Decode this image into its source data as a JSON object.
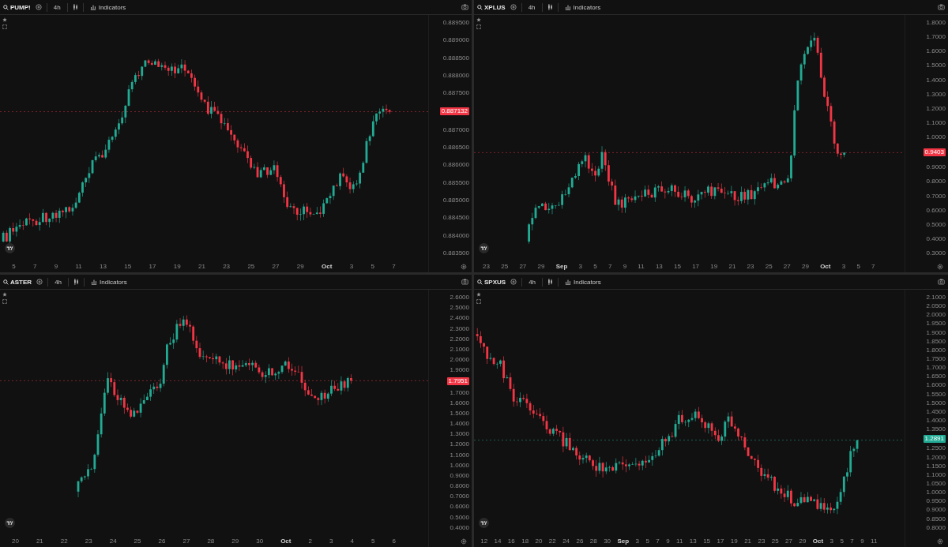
{
  "panels": [
    {
      "symbol": "PUMP!",
      "interval": "4h",
      "indicators": "Indicators",
      "price_labels": [
        {
          "text": "0.889500",
          "kind": "tick"
        },
        {
          "text": "0.889000",
          "kind": "tick"
        },
        {
          "text": "0.888500",
          "kind": "tick"
        },
        {
          "text": "0.888000",
          "kind": "tick"
        },
        {
          "text": "0.887500",
          "kind": "tick"
        },
        {
          "text": "0.887132",
          "kind": "current",
          "color": "#f23645"
        },
        {
          "text": "0.887000",
          "kind": "tick"
        },
        {
          "text": "0.886500",
          "kind": "tick"
        },
        {
          "text": "0.886000",
          "kind": "tick"
        },
        {
          "text": "0.885500",
          "kind": "tick"
        },
        {
          "text": "0.885000",
          "kind": "tick"
        },
        {
          "text": "0.884500",
          "kind": "tick"
        },
        {
          "text": "0.884000",
          "kind": "tick"
        },
        {
          "text": "0.883500",
          "kind": "tick"
        }
      ],
      "time_labels": [
        {
          "text": "5",
          "kind": "day"
        },
        {
          "text": "7",
          "kind": "day"
        },
        {
          "text": "9",
          "kind": "day"
        },
        {
          "text": "11",
          "kind": "day"
        },
        {
          "text": "13",
          "kind": "day"
        },
        {
          "text": "15",
          "kind": "day"
        },
        {
          "text": "17",
          "kind": "day"
        },
        {
          "text": "19",
          "kind": "day"
        },
        {
          "text": "21",
          "kind": "day"
        },
        {
          "text": "23",
          "kind": "day"
        },
        {
          "text": "25",
          "kind": "day"
        },
        {
          "text": "27",
          "kind": "day"
        },
        {
          "text": "29",
          "kind": "day"
        },
        {
          "text": "Oct",
          "kind": "month"
        },
        {
          "text": "3",
          "kind": "day"
        },
        {
          "text": "5",
          "kind": "day"
        },
        {
          "text": "7",
          "kind": "day"
        }
      ]
    },
    {
      "symbol": "XPLUS",
      "interval": "4h",
      "indicators": "Indicators",
      "price_labels": [
        {
          "text": "1.8000",
          "kind": "tick"
        },
        {
          "text": "1.7000",
          "kind": "tick"
        },
        {
          "text": "1.6000",
          "kind": "tick"
        },
        {
          "text": "1.5000",
          "kind": "tick"
        },
        {
          "text": "1.4000",
          "kind": "tick"
        },
        {
          "text": "1.3000",
          "kind": "tick"
        },
        {
          "text": "1.2000",
          "kind": "tick"
        },
        {
          "text": "1.1000",
          "kind": "tick"
        },
        {
          "text": "1.0000",
          "kind": "tick"
        },
        {
          "text": "0.9403",
          "kind": "current",
          "color": "#f23645"
        },
        {
          "text": "0.9000",
          "kind": "tick"
        },
        {
          "text": "0.8000",
          "kind": "tick"
        },
        {
          "text": "0.7000",
          "kind": "tick"
        },
        {
          "text": "0.6000",
          "kind": "tick"
        },
        {
          "text": "0.5000",
          "kind": "tick"
        },
        {
          "text": "0.4000",
          "kind": "tick"
        },
        {
          "text": "0.3000",
          "kind": "tick"
        }
      ],
      "time_labels": [
        {
          "text": "23",
          "kind": "day"
        },
        {
          "text": "25",
          "kind": "day"
        },
        {
          "text": "27",
          "kind": "day"
        },
        {
          "text": "29",
          "kind": "day"
        },
        {
          "text": "Sep",
          "kind": "month"
        },
        {
          "text": "3",
          "kind": "day"
        },
        {
          "text": "5",
          "kind": "day"
        },
        {
          "text": "7",
          "kind": "day"
        },
        {
          "text": "9",
          "kind": "day"
        },
        {
          "text": "11",
          "kind": "day"
        },
        {
          "text": "13",
          "kind": "day"
        },
        {
          "text": "15",
          "kind": "day"
        },
        {
          "text": "17",
          "kind": "day"
        },
        {
          "text": "19",
          "kind": "day"
        },
        {
          "text": "21",
          "kind": "day"
        },
        {
          "text": "23",
          "kind": "day"
        },
        {
          "text": "25",
          "kind": "day"
        },
        {
          "text": "27",
          "kind": "day"
        },
        {
          "text": "29",
          "kind": "day"
        },
        {
          "text": "Oct",
          "kind": "month"
        },
        {
          "text": "3",
          "kind": "day"
        },
        {
          "text": "5",
          "kind": "day"
        },
        {
          "text": "7",
          "kind": "day"
        }
      ]
    },
    {
      "symbol": "ASTER",
      "interval": "4h",
      "indicators": "Indicators",
      "price_labels": [
        {
          "text": "2.6000",
          "kind": "tick"
        },
        {
          "text": "2.5000",
          "kind": "tick"
        },
        {
          "text": "2.4000",
          "kind": "tick"
        },
        {
          "text": "2.3000",
          "kind": "tick"
        },
        {
          "text": "2.2000",
          "kind": "tick"
        },
        {
          "text": "2.1000",
          "kind": "tick"
        },
        {
          "text": "2.0000",
          "kind": "tick"
        },
        {
          "text": "1.9000",
          "kind": "tick"
        },
        {
          "text": "1.7951",
          "kind": "current",
          "color": "#f23645"
        },
        {
          "text": "1.7000",
          "kind": "tick"
        },
        {
          "text": "1.6000",
          "kind": "tick"
        },
        {
          "text": "1.5000",
          "kind": "tick"
        },
        {
          "text": "1.4000",
          "kind": "tick"
        },
        {
          "text": "1.3000",
          "kind": "tick"
        },
        {
          "text": "1.2000",
          "kind": "tick"
        },
        {
          "text": "1.1000",
          "kind": "tick"
        },
        {
          "text": "1.0000",
          "kind": "tick"
        },
        {
          "text": "0.9000",
          "kind": "tick"
        },
        {
          "text": "0.8000",
          "kind": "tick"
        },
        {
          "text": "0.7000",
          "kind": "tick"
        },
        {
          "text": "0.6000",
          "kind": "tick"
        },
        {
          "text": "0.5000",
          "kind": "tick"
        },
        {
          "text": "0.4000",
          "kind": "tick"
        }
      ],
      "time_labels": [
        {
          "text": "20",
          "kind": "day"
        },
        {
          "text": "21",
          "kind": "day"
        },
        {
          "text": "22",
          "kind": "day"
        },
        {
          "text": "23",
          "kind": "day"
        },
        {
          "text": "24",
          "kind": "day"
        },
        {
          "text": "25",
          "kind": "day"
        },
        {
          "text": "26",
          "kind": "day"
        },
        {
          "text": "27",
          "kind": "day"
        },
        {
          "text": "28",
          "kind": "day"
        },
        {
          "text": "29",
          "kind": "day"
        },
        {
          "text": "30",
          "kind": "day"
        },
        {
          "text": "Oct",
          "kind": "month"
        },
        {
          "text": "2",
          "kind": "day"
        },
        {
          "text": "3",
          "kind": "day"
        },
        {
          "text": "4",
          "kind": "day"
        },
        {
          "text": "5",
          "kind": "day"
        },
        {
          "text": "6",
          "kind": "day"
        }
      ]
    },
    {
      "symbol": "SPXUS",
      "interval": "4h",
      "indicators": "Indicators",
      "price_labels": [
        {
          "text": "2.1000",
          "kind": "tick"
        },
        {
          "text": "2.0500",
          "kind": "tick"
        },
        {
          "text": "2.0000",
          "kind": "tick"
        },
        {
          "text": "1.9500",
          "kind": "tick"
        },
        {
          "text": "1.9000",
          "kind": "tick"
        },
        {
          "text": "1.8500",
          "kind": "tick"
        },
        {
          "text": "1.8000",
          "kind": "tick"
        },
        {
          "text": "1.7500",
          "kind": "tick"
        },
        {
          "text": "1.7000",
          "kind": "tick"
        },
        {
          "text": "1.6500",
          "kind": "tick"
        },
        {
          "text": "1.6000",
          "kind": "tick"
        },
        {
          "text": "1.5500",
          "kind": "tick"
        },
        {
          "text": "1.5000",
          "kind": "tick"
        },
        {
          "text": "1.4500",
          "kind": "tick"
        },
        {
          "text": "1.4000",
          "kind": "tick"
        },
        {
          "text": "1.3500",
          "kind": "tick"
        },
        {
          "text": "1.2891",
          "kind": "current",
          "color": "#22ab94"
        },
        {
          "text": "1.2500",
          "kind": "tick"
        },
        {
          "text": "1.2000",
          "kind": "tick"
        },
        {
          "text": "1.1500",
          "kind": "tick"
        },
        {
          "text": "1.1000",
          "kind": "tick"
        },
        {
          "text": "1.0500",
          "kind": "tick"
        },
        {
          "text": "1.0000",
          "kind": "tick"
        },
        {
          "text": "0.9500",
          "kind": "tick"
        },
        {
          "text": "0.9000",
          "kind": "tick"
        },
        {
          "text": "0.8500",
          "kind": "tick"
        },
        {
          "text": "0.8000",
          "kind": "tick"
        }
      ],
      "time_labels": [
        {
          "text": "12",
          "kind": "day"
        },
        {
          "text": "14",
          "kind": "day"
        },
        {
          "text": "16",
          "kind": "day"
        },
        {
          "text": "18",
          "kind": "day"
        },
        {
          "text": "20",
          "kind": "day"
        },
        {
          "text": "22",
          "kind": "day"
        },
        {
          "text": "24",
          "kind": "day"
        },
        {
          "text": "26",
          "kind": "day"
        },
        {
          "text": "28",
          "kind": "day"
        },
        {
          "text": "30",
          "kind": "day"
        },
        {
          "text": "Sep",
          "kind": "month"
        },
        {
          "text": "3",
          "kind": "day"
        },
        {
          "text": "5",
          "kind": "day"
        },
        {
          "text": "7",
          "kind": "day"
        },
        {
          "text": "9",
          "kind": "day"
        },
        {
          "text": "11",
          "kind": "day"
        },
        {
          "text": "13",
          "kind": "day"
        },
        {
          "text": "15",
          "kind": "day"
        },
        {
          "text": "17",
          "kind": "day"
        },
        {
          "text": "19",
          "kind": "day"
        },
        {
          "text": "21",
          "kind": "day"
        },
        {
          "text": "23",
          "kind": "day"
        },
        {
          "text": "25",
          "kind": "day"
        },
        {
          "text": "27",
          "kind": "day"
        },
        {
          "text": "29",
          "kind": "day"
        },
        {
          "text": "Oct",
          "kind": "month"
        },
        {
          "text": "3",
          "kind": "day"
        },
        {
          "text": "5",
          "kind": "day"
        },
        {
          "text": "7",
          "kind": "day"
        },
        {
          "text": "9",
          "kind": "day"
        },
        {
          "text": "11",
          "kind": "day"
        }
      ]
    }
  ]
}
